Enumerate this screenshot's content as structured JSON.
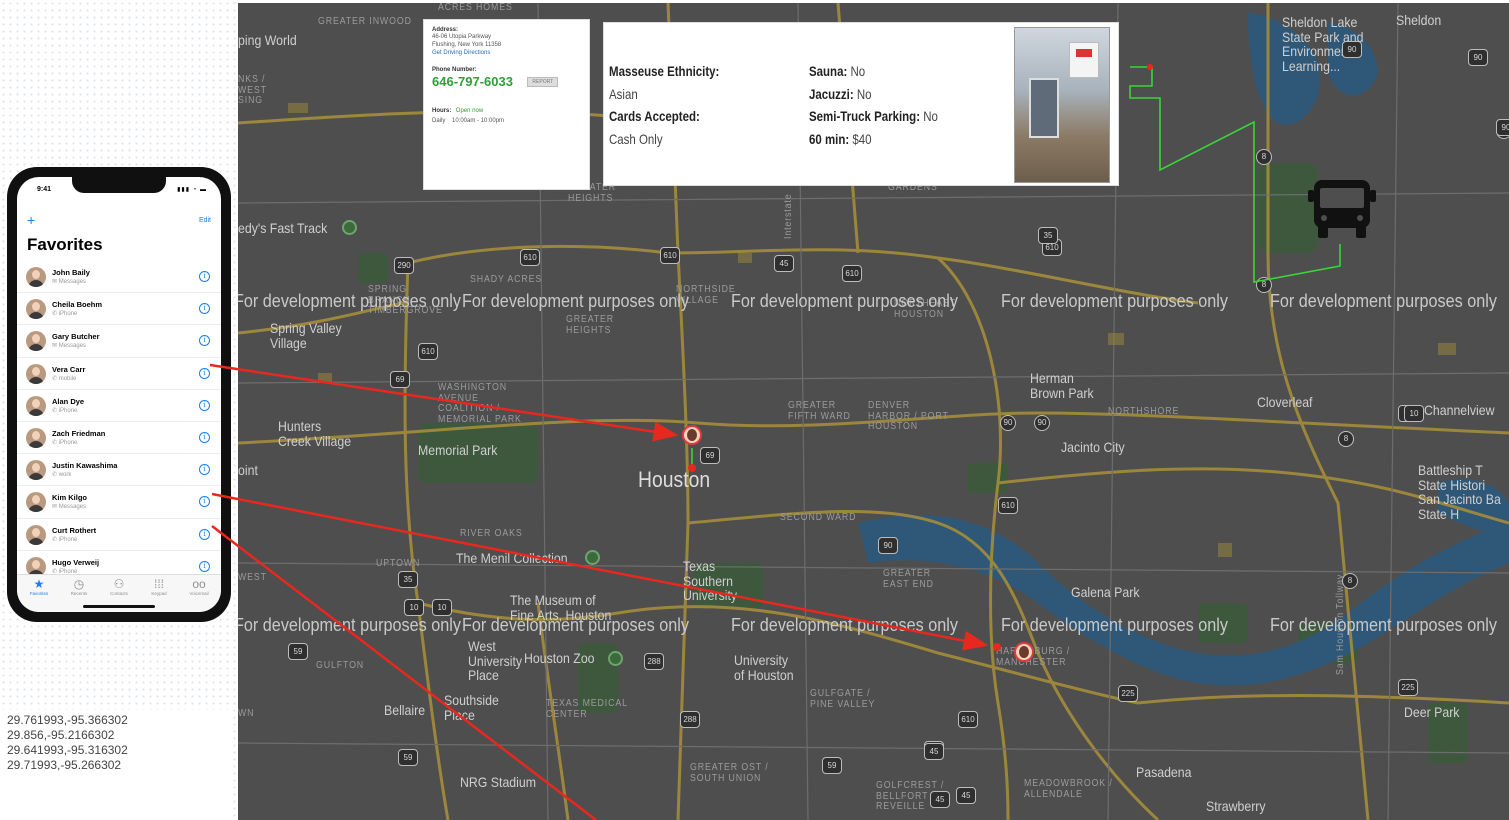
{
  "map": {
    "watermark": "For development purposes only",
    "labels": {
      "houston": "Houston",
      "pasadena": "Pasadena",
      "jacinto_city": "Jacinto City",
      "galena_park": "Galena Park",
      "cloverleaf": "Cloverleaf",
      "channelview": "Channelview",
      "deer_park": "Deer Park",
      "bellaire": "Bellaire",
      "memorial_park": "Memorial Park",
      "hunters_creek": "Hunters\nCreek Village",
      "spring_valley": "Spring Valley\nVillage",
      "herman_brown": "Herman\nBrown Park",
      "sheldon_lake": "Sheldon Lake\nState Park and\nEnvironmental\nLearning...",
      "sheldon": "Sheldon",
      "battleship": "Battleship T\nState Histori\nSan Jacinto Ba\nState H",
      "menil": "The Menil Collection",
      "museum": "The Museum of\nFine Arts, Houston",
      "west_university": "West\nUniversity\nPlace",
      "houston_zoo": "Houston Zoo",
      "university_houston": "University\nof Houston",
      "texas_southern": "Texas\nSouthern\nUniversity",
      "southside": "Southside\nPlace",
      "nrg": "NRG Stadium",
      "strawberry": "Strawberry",
      "fast_track": "edy's Fast Track",
      "ping_world": "ping World",
      "point": "oint",
      "greater_inwood": "GREATER\nINWOOD",
      "acres_homes": "ACRES HOMES",
      "shady_acres": "SHADY ACRES",
      "spring_branch": "SPRING\nBRANCH\nTIMBERGROVE",
      "greater_heights": "GREATER\nHEIGHTS",
      "washington": "WASHINGTON\nAVENUE\nCOALITION /\nMEMORIAL PARK",
      "northside": "NORTHSIDE\nVILLAGE",
      "fifth_ward": "GREATER\nFIFTH WARD",
      "denver": "DENVER\nHARBOR / PORT\nHOUSTON",
      "northshore": "NORTHSHORE",
      "second_ward": "SECOND WARD",
      "greater_east_end": "GREATER\nEAST END",
      "river_oaks": "RIVER OAKS",
      "uptown": "UPTOWN",
      "gulfton": "GULFTON",
      "texas_medical": "TEXAS MEDICAL\nCENTER",
      "gulfgate": "GULFGATE /\nPINE VALLEY",
      "greater_ost": "GREATER OST /\nSOUTH UNION",
      "golfcrest": "GOLFCREST /\nBELLFORT /\nREVEILLE",
      "meadowbrook": "MEADOWBROOK /\nALLENDALE",
      "harrisburg": "HARRISBURG /\nMANCHESTER",
      "northeast": "NORTHEAST\nHOUSTON",
      "east_little_york": "EAST LITTLE YORK /\nHOMESTEAD",
      "gardens": "GARDENS",
      "sam_houston": "Sam Houston Tollway",
      "interstate": "Interstate",
      "west_edge": "WEST",
      "nks_west": "NKS /\nWEST\nSING",
      "wn": "WN"
    },
    "shields": [
      "290",
      "610",
      "610",
      "45",
      "610",
      "610",
      "69",
      "69",
      "90",
      "90",
      "8",
      "8",
      "90",
      "8",
      "225",
      "610",
      "45",
      "610",
      "225",
      "288",
      "288",
      "90",
      "35",
      "10",
      "10",
      "59",
      "59",
      "90",
      "8",
      "90",
      "610",
      "8",
      "45",
      "45",
      "59",
      "45",
      "35",
      "90",
      "90",
      "10"
    ]
  },
  "address_card": {
    "address_label": "Address:",
    "address_line1": "46-06 Utopia Parkway",
    "address_line2": "Flushing, New York 11358",
    "directions_link": "Get Driving Directions",
    "phone_label": "Phone Number:",
    "phone": "646-797-6033",
    "report": "REPORT",
    "hours_label": "Hours:",
    "hours_status": "Open now",
    "hours_line": "Daily    10:00am - 10:00pm"
  },
  "details_card": {
    "ethnicity_label": "Masseuse Ethnicity:",
    "ethnicity_value": "Asian",
    "cards_label": "Cards Accepted:",
    "cards_value": "Cash Only",
    "sauna_label": "Sauna:",
    "sauna_value": "No",
    "jacuzzi_label": "Jacuzzi:",
    "jacuzzi_value": "No",
    "parking_label": "Semi-Truck Parking:",
    "parking_value": "No",
    "price_label": "60 min:",
    "price_value": "$40"
  },
  "phone": {
    "time": "9:41",
    "status_icons": "▮▮▮ ◔ ▬",
    "add": "+",
    "edit": "Edit",
    "title": "Favorites",
    "contacts": [
      {
        "name": "John Baily",
        "type": "✉ Messages"
      },
      {
        "name": "Cheila Boehm",
        "type": "✆ iPhone"
      },
      {
        "name": "Gary Butcher",
        "type": "✉ Messages"
      },
      {
        "name": "Vera Carr",
        "type": "✆ mobile"
      },
      {
        "name": "Alan Dye",
        "type": "✆ iPhone"
      },
      {
        "name": "Zach Friedman",
        "type": "✆ iPhone"
      },
      {
        "name": "Justin Kawashima",
        "type": "✆ work"
      },
      {
        "name": "Kim Kilgo",
        "type": "✉ Messages"
      },
      {
        "name": "Curt Rothert",
        "type": "✆ iPhone"
      },
      {
        "name": "Hugo Verweij",
        "type": "✆ iPhone"
      }
    ],
    "tabs": [
      {
        "label": "Favorites",
        "icon": "★"
      },
      {
        "label": "Recents",
        "icon": "◷"
      },
      {
        "label": "Contacts",
        "icon": "⚇"
      },
      {
        "label": "Keypad",
        "icon": "⁞⁞⁞"
      },
      {
        "label": "Voicemail",
        "icon": "oo"
      }
    ]
  },
  "coordinates": [
    "29.761993,-95.366302",
    "29.856,-95.2166302",
    "29.641993,-95.316302",
    "29.71993,-95.266302"
  ],
  "colors": {
    "map_bg": "#4e4e4e",
    "highway": "#a08a3c",
    "water": "#2f5878",
    "park": "#3c5a3c",
    "arrow": "#e8281e",
    "route": "#39d639",
    "ios_blue": "#1a7ef2",
    "phone_green": "#2f9e3a"
  }
}
